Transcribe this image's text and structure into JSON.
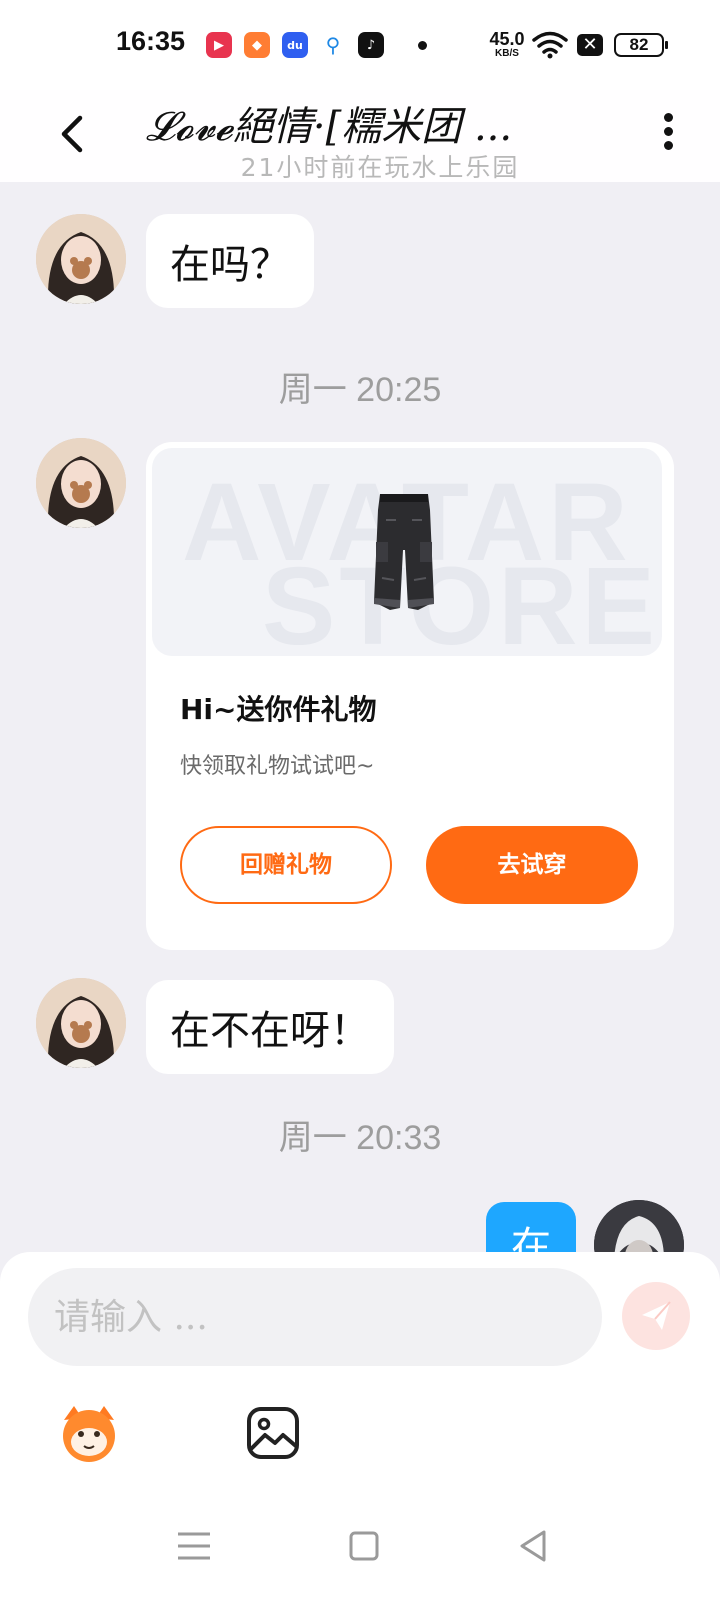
{
  "status_bar": {
    "time": "16:35",
    "apps": [
      {
        "icon": "video-app-icon",
        "glyph": "▶",
        "color": "#e8344f"
      },
      {
        "icon": "fruit-app-icon",
        "glyph": "◆",
        "color": "#ff7d33"
      },
      {
        "icon": "baidu-app-icon",
        "glyph": "du",
        "color": "#2f5ff0"
      },
      {
        "icon": "search-app-icon",
        "glyph": "Q",
        "color": "#1e88e5"
      },
      {
        "icon": "tiktok-app-icon",
        "glyph": "♪",
        "color": "#111111"
      }
    ],
    "net_speed": "45.0",
    "net_unit": "KB/S",
    "battery": "82"
  },
  "header": {
    "title": "𝓛𝓸𝓿𝓮絕情·[糯米团 ...",
    "subtitle": "21小时前在玩水上乐园"
  },
  "messages": {
    "msg1": "在吗？",
    "divider1": "周一 20:25",
    "gift": {
      "watermark_line1": "AVATAR",
      "watermark_line2": "STORE",
      "title": "Hi~送你件礼物",
      "desc": "快领取礼物试试吧~",
      "return_gift_label": "回赠礼物",
      "try_on_label": "去试穿"
    },
    "msg2": "在不在呀！",
    "divider2": "周一 20:33",
    "my_msg_partial": "在"
  },
  "composer": {
    "placeholder": "请输入 ...",
    "value": ""
  },
  "colors": {
    "accent": "#ff6a13",
    "my_bubble": "#1ea7ff",
    "background": "#f0eff4"
  }
}
